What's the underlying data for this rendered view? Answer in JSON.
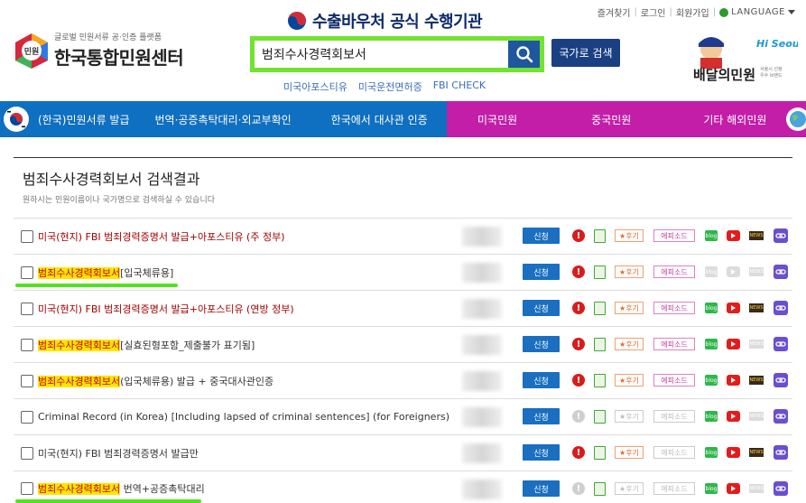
{
  "utility": {
    "items": [
      "즐겨찾기",
      "로그인",
      "회원가입"
    ],
    "language": "LANGUAGE"
  },
  "logo": {
    "badge": "민원",
    "subtitle": "글로벌 민원서류 공·인증 플랫폼",
    "title": "한국통합민원센터"
  },
  "banner": {
    "text": "수출바우처 공식 수행기관"
  },
  "search": {
    "value": "범죄수사경력회보서",
    "country_button": "국가로 검색"
  },
  "quick_links": [
    "미국아포스티유",
    "미국운전면허증",
    "FBI CHECK"
  ],
  "delivery": {
    "title": "배달의민원",
    "brand": "Hi Seoul",
    "caption": "서울시 선정\n우수 브랜드"
  },
  "nav": {
    "items": [
      "(한국)민원서류 발급",
      "번역·공증촉탁대리·외교부확인",
      "한국에서 대사관 인증",
      "미국민원",
      "중국민원",
      "기타 해외민원"
    ]
  },
  "results": {
    "title": "범죄수사경력회보서 검색결과",
    "subtitle": "원하시는 민원이름이나 국가명으로 검색하실 수 있습니다",
    "apply_label": "신청",
    "review_label": "★후기",
    "episode_label": "에피소드",
    "blog_label": "blog",
    "news_label": "NEWS",
    "rows": [
      {
        "parts": [
          [
            "red",
            "미국(현지) FBI 범죄경력증명서 발급+아포스티유 (주 정부)"
          ]
        ],
        "warn": true,
        "episode": true,
        "blog": true,
        "yt": true,
        "news": true,
        "underline": false
      },
      {
        "parts": [
          [
            "hl",
            "범죄수사경력회보서"
          ],
          [
            "plain",
            "[입국체류용]"
          ]
        ],
        "warn": true,
        "episode": true,
        "blog": false,
        "yt": false,
        "news": false,
        "underline": true
      },
      {
        "parts": [
          [
            "red",
            "미국(현지) FBI 범죄경력증명서 발급+아포스티유 (연방 정부)"
          ]
        ],
        "warn": true,
        "episode": true,
        "blog": true,
        "yt": true,
        "news": true,
        "underline": false
      },
      {
        "parts": [
          [
            "hl",
            "범죄수사경력회보서"
          ],
          [
            "plain",
            "[실효된형포함_제출불가 표기됨]"
          ]
        ],
        "warn": true,
        "episode": true,
        "blog": true,
        "yt": true,
        "news": false,
        "underline": false
      },
      {
        "parts": [
          [
            "hl",
            "범죄수사경력회보서"
          ],
          [
            "plain",
            "(입국체류용) 발급 + 중국대사관인증"
          ]
        ],
        "warn": true,
        "episode": true,
        "blog": true,
        "yt": true,
        "news": true,
        "underline": false
      },
      {
        "parts": [
          [
            "plain",
            "Criminal Record (in Korea) [Including lapsed of criminal sentences] (for Foreigners)"
          ]
        ],
        "warn": false,
        "episode": false,
        "blog": true,
        "yt": true,
        "news": false,
        "underline": false
      },
      {
        "parts": [
          [
            "plain",
            "미국(현지) FBI 범죄경력증명서 발급만"
          ]
        ],
        "warn": true,
        "episode": false,
        "blog": true,
        "yt": true,
        "news": true,
        "underline": false
      },
      {
        "parts": [
          [
            "hl",
            "범죄수사경력회보서"
          ],
          [
            "plain",
            " 번역+공증촉탁대리"
          ]
        ],
        "warn": false,
        "episode": false,
        "blog": true,
        "yt": true,
        "news": false,
        "underline": true
      }
    ]
  },
  "colors": {
    "nav_blue": "#0f6fc0",
    "nav_pink": "#c21ea8",
    "search_border": "#72e32e",
    "apply": "#1a6fc1"
  }
}
